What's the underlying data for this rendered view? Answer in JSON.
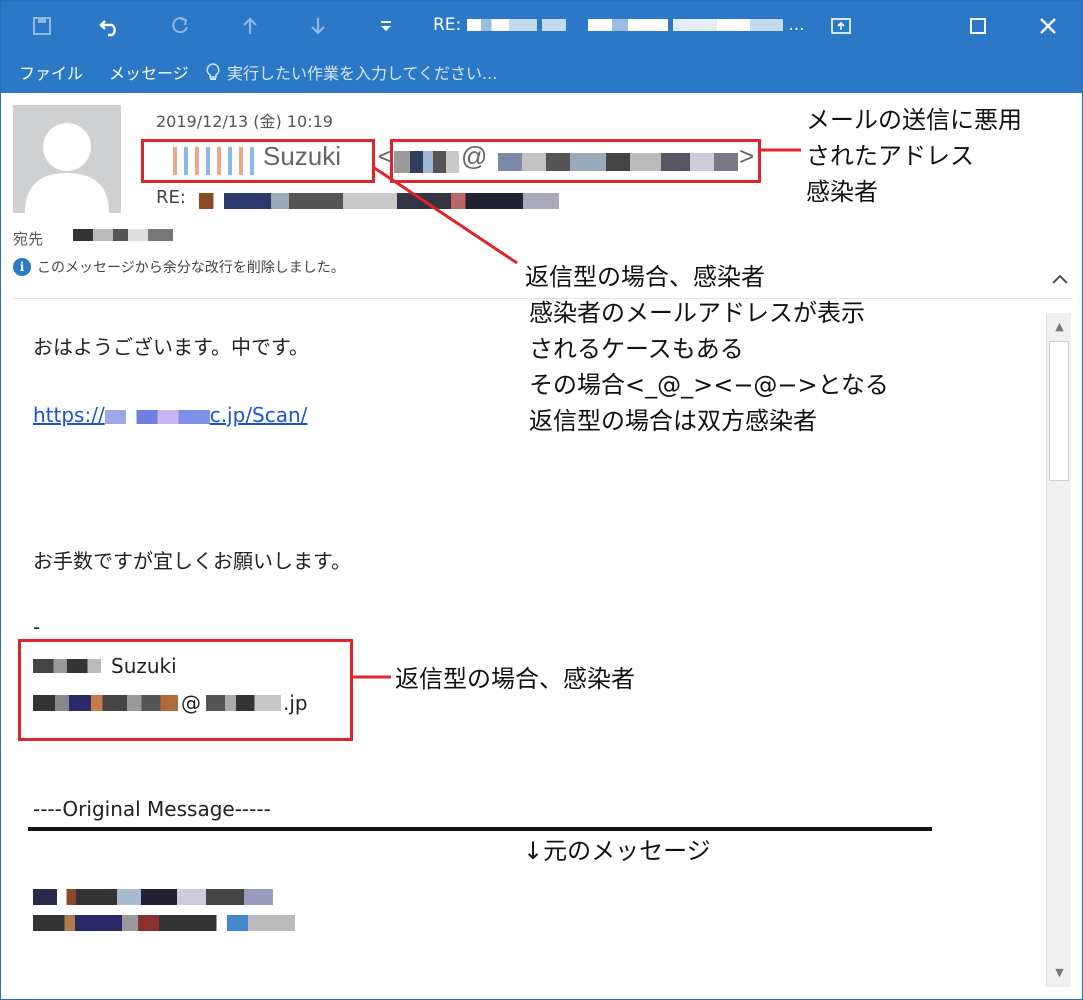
{
  "titlebar": {
    "title_prefix": "RE:",
    "icons": [
      "save-icon",
      "undo-icon",
      "redo-icon",
      "up-arrow-icon",
      "down-arrow-icon",
      "dropdown-icon"
    ],
    "window_controls": [
      "restore-popout-icon",
      "maximize-icon",
      "close-icon"
    ]
  },
  "ribbon": {
    "file_label": "ファイル",
    "message_label": "メッセージ",
    "search_placeholder": "実行したい作業を入力してください..."
  },
  "header": {
    "date": "2019/12/13 (金) 10:19",
    "sender_name": "Suzuki",
    "sender_addr_open": "<",
    "sender_addr_at": "@",
    "sender_addr_close": ">",
    "subject_prefix": "RE:",
    "to_label": "宛先",
    "info_text": "このメッセージから余分な改行を削除しました。"
  },
  "annotations": {
    "top_right": [
      "メールの送信に悪用",
      "されたアドレス",
      "感染者"
    ],
    "middle": [
      "返信型の場合、感染者",
      "感染者のメールアドレスが表示",
      "されるケースもある",
      "その場合<_@_><−@−>となる",
      "返信型の場合は双方感染者"
    ],
    "signature": "返信型の場合、感染者",
    "original": "↓元のメッセージ"
  },
  "body": {
    "greeting": "おはようございます。中です。",
    "link_prefix": "https://",
    "link_domain": "c.jp",
    "link_path": "/Scan/",
    "closing": "お手数ですが宜しくお願いします。",
    "dash": "-",
    "sig_name": "Suzuki",
    "sig_at": "@",
    "sig_tld": ".jp",
    "original_header": "----Original Message-----"
  },
  "colors": {
    "titlebar": "#2b78c6",
    "highlight_box": "#e0242b",
    "link": "#1a55cc"
  }
}
